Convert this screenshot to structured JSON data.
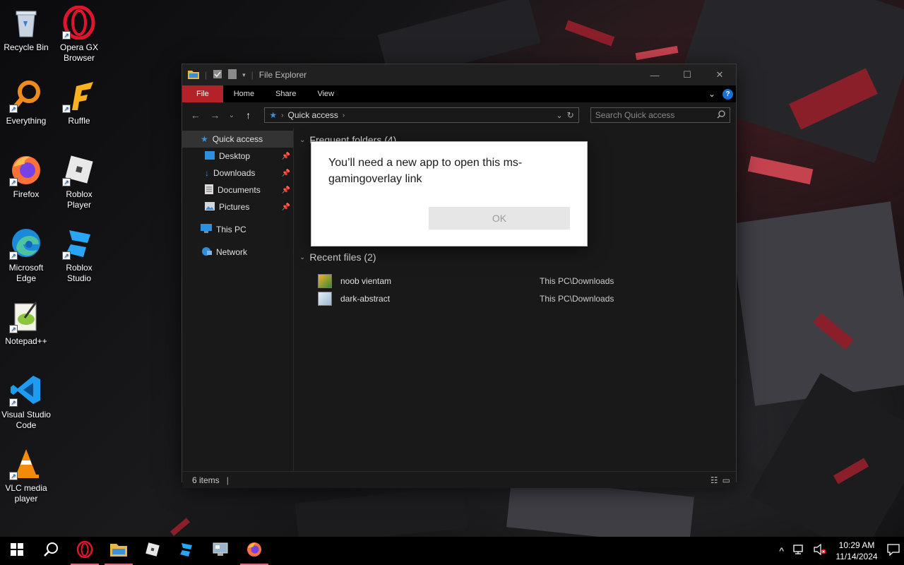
{
  "desktop": {
    "icons": [
      {
        "label": "Recycle Bin"
      },
      {
        "label": "Opera GX Browser"
      },
      {
        "label": "Everything"
      },
      {
        "label": "Ruffle"
      },
      {
        "label": "Firefox"
      },
      {
        "label": "Roblox Player"
      },
      {
        "label": "Microsoft Edge"
      },
      {
        "label": "Roblox Studio"
      },
      {
        "label": "Notepad++"
      },
      {
        "label": "Visual Studio Code"
      },
      {
        "label": "VLC media player"
      }
    ]
  },
  "explorer": {
    "title": "File Explorer",
    "ribbon": {
      "file": "File",
      "home": "Home",
      "share": "Share",
      "view": "View"
    },
    "address": {
      "path": "Quick access"
    },
    "search": {
      "placeholder": "Search Quick access"
    },
    "nav": {
      "quick_access": "Quick access",
      "desktop": "Desktop",
      "downloads": "Downloads",
      "documents": "Documents",
      "pictures": "Pictures",
      "this_pc": "This PC",
      "network": "Network"
    },
    "groups": {
      "frequent": "Frequent folders (4)",
      "recent": "Recent files (2)"
    },
    "recent_files": [
      {
        "name": "noob vientam",
        "location": "This PC\\Downloads"
      },
      {
        "name": "dark-abstract",
        "location": "This PC\\Downloads"
      }
    ],
    "status": {
      "items": "6 items"
    }
  },
  "dialog": {
    "message": "You’ll need a new app to open this ms-gamingoverlay link",
    "ok": "OK"
  },
  "taskbar": {
    "time": "10:29 AM",
    "date": "11/14/2024"
  }
}
